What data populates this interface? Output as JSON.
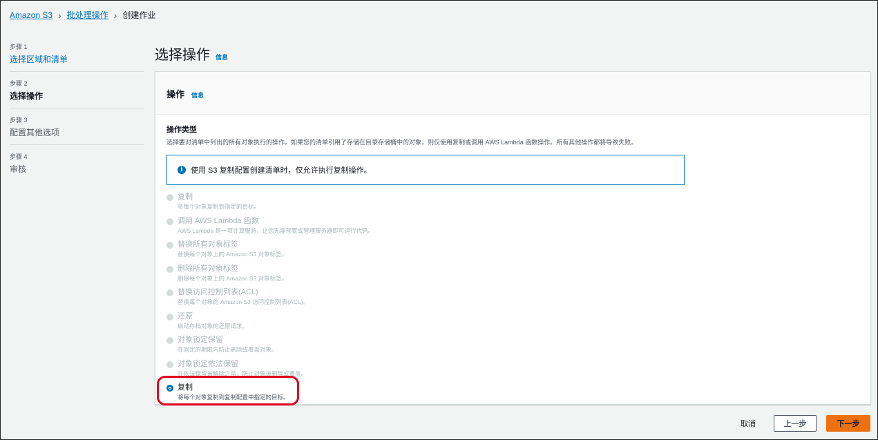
{
  "breadcrumb": {
    "items": [
      {
        "label": "Amazon S3"
      },
      {
        "label": "批处理操作"
      },
      {
        "label": "创建作业"
      }
    ]
  },
  "steps": [
    {
      "num": "步骤 1",
      "label": "选择区域和清单"
    },
    {
      "num": "步骤 2",
      "label": "选择操作"
    },
    {
      "num": "步骤 3",
      "label": "配置其他选项"
    },
    {
      "num": "步骤 4",
      "label": "审核"
    }
  ],
  "page": {
    "title": "选择操作",
    "info": "信息"
  },
  "panel": {
    "title": "操作",
    "info": "信息",
    "field_label": "操作类型",
    "field_desc": "选择要对清单中列出的所有对象执行的操作。如果您的清单引用了存储在目录存储桶中的对象，则仅使用复制或调用 AWS Lambda 函数操作。所有其他操作都将导致失败。",
    "alert_icon": "i",
    "alert_text": "使用 S3 复制配置创建清单时，仅允许执行复制操作。",
    "options": [
      {
        "label": "复制",
        "desc": "将每个对象复制到指定的目标。"
      },
      {
        "label": "调用 AWS Lambda 函数",
        "desc": "AWS Lambda 是一项计算服务，让您无需预置或管理服务器即可运行代码。"
      },
      {
        "label": "替换所有对象标签",
        "desc": "替换每个对象上的 Amazon S3 对象标签。"
      },
      {
        "label": "删除所有对象标签",
        "desc": "删除每个对象上的 Amazon S3 对象标签。"
      },
      {
        "label": "替换访问控制列表(ACL)",
        "desc": "替换每个对象的 Amazon S3 访问控制列表(ACL)。"
      },
      {
        "label": "还原",
        "desc": "启动存档对象的还原请求。"
      },
      {
        "label": "对象锁定保留",
        "desc": "在固定的期限内防止删除或覆盖对象。"
      },
      {
        "label": "对象锁定依法保留",
        "desc": "在依法保留被解除之前，防止对象被删除或覆盖。"
      },
      {
        "label": "复制",
        "desc": "将每个对象复制到复制配置中指定的目标。"
      }
    ],
    "selected_option": "复制"
  },
  "footer": {
    "cancel": "取消",
    "previous": "上一步",
    "next": "下一步"
  },
  "colors": {
    "link": "#0073bb",
    "primary_button": "#ec7211",
    "highlight": "#e0001b"
  }
}
